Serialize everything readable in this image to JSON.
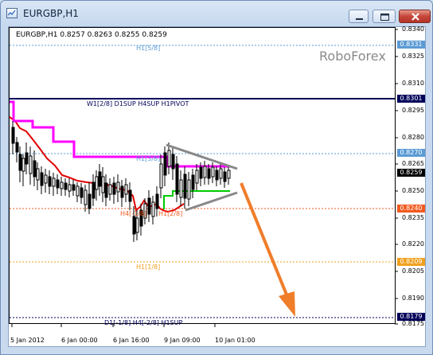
{
  "window": {
    "title": "EURGBP,H1"
  },
  "chart": {
    "info": "EURGBP,H1  0.8257 0.8263 0.8255 0.8259",
    "watermark": "RoboForex",
    "price_scale": [
      "0.8340",
      "0.8325",
      "0.8310",
      "0.8295",
      "0.8280",
      "0.8265",
      "0.8250",
      "0.8235",
      "0.8220",
      "0.8205",
      "0.8190",
      "0.8175"
    ],
    "price_tags": [
      {
        "label": "0.8331",
        "color": "#5b9bd5"
      },
      {
        "label": "0.8301",
        "color": "#00005a"
      },
      {
        "label": "0.8270",
        "color": "#5b9bd5"
      },
      {
        "label": "0.8259",
        "color": "#000000"
      },
      {
        "label": "0.8240",
        "color": "#f25a20"
      },
      {
        "label": "0.8209",
        "color": "#f0a020"
      },
      {
        "label": "0.8179",
        "color": "#00005a"
      }
    ],
    "levels": [
      {
        "label": "H1[5/8]",
        "color": "#5b9bd5"
      },
      {
        "label": "W1[2/8] D1SUP H4SUP H1PIVOT",
        "color": "#00005a"
      },
      {
        "label": "H1[3/8]",
        "color": "#5b9bd5"
      },
      {
        "label": "H4[-1/8]",
        "color": "#f25a20"
      },
      {
        "label": "H1[2/8]",
        "color": "#f25a20"
      },
      {
        "label": "H1[1/8]",
        "color": "#f0a020"
      },
      {
        "label": "D1[-1/8] H4[-2/8] H1SUP",
        "color": "#00005a"
      }
    ],
    "time_labels": [
      "5 Jan 2012",
      "6 Jan 00:00",
      "6 Jan 16:00",
      "9 Jan 09:00",
      "10 Jan 01:00"
    ],
    "colors": {
      "upper_envelope": "#ff00ff",
      "lower_envelope": "#00cc00",
      "red_line": "#e00000",
      "triangle": "#888888",
      "arrow": "#f07d2a"
    }
  }
}
